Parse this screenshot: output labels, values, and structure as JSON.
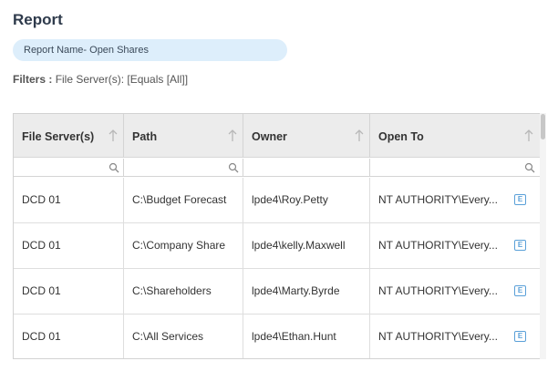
{
  "page": {
    "title": "Report"
  },
  "report": {
    "name": "Report Name- Open Shares"
  },
  "filters": {
    "label": "Filters :",
    "value": "File Server(s): [Equals [All]]"
  },
  "table": {
    "columns": [
      {
        "label": "File Server(s)"
      },
      {
        "label": "Path"
      },
      {
        "label": "Owner"
      },
      {
        "label": "Open To"
      }
    ],
    "rows": [
      {
        "server": "DCD 01",
        "path": "C:\\Budget Forecast",
        "owner": "lpde4\\Roy.Petty",
        "open_to": "NT AUTHORITY\\Every..."
      },
      {
        "server": "DCD 01",
        "path": "C:\\Company Share",
        "owner": "lpde4\\kelly.Maxwell",
        "open_to": "NT AUTHORITY\\Every..."
      },
      {
        "server": "DCD 01",
        "path": "C:\\Shareholders",
        "owner": "lpde4\\Marty.Byrde",
        "open_to": "NT AUTHORITY\\Every..."
      },
      {
        "server": "DCD 01",
        "path": "C:\\All Services",
        "owner": "lpde4\\Ethan.Hunt",
        "open_to": "NT AUTHORITY\\Every..."
      }
    ],
    "row_icon_letter": "E"
  },
  "colors": {
    "accent": "#5aa0d8",
    "pill_bg": "#ddeefb",
    "header_bg": "#ececec"
  },
  "icons": {
    "sort": "sort-ascending-icon",
    "filter": "search-icon",
    "row_action": "expand-icon"
  }
}
